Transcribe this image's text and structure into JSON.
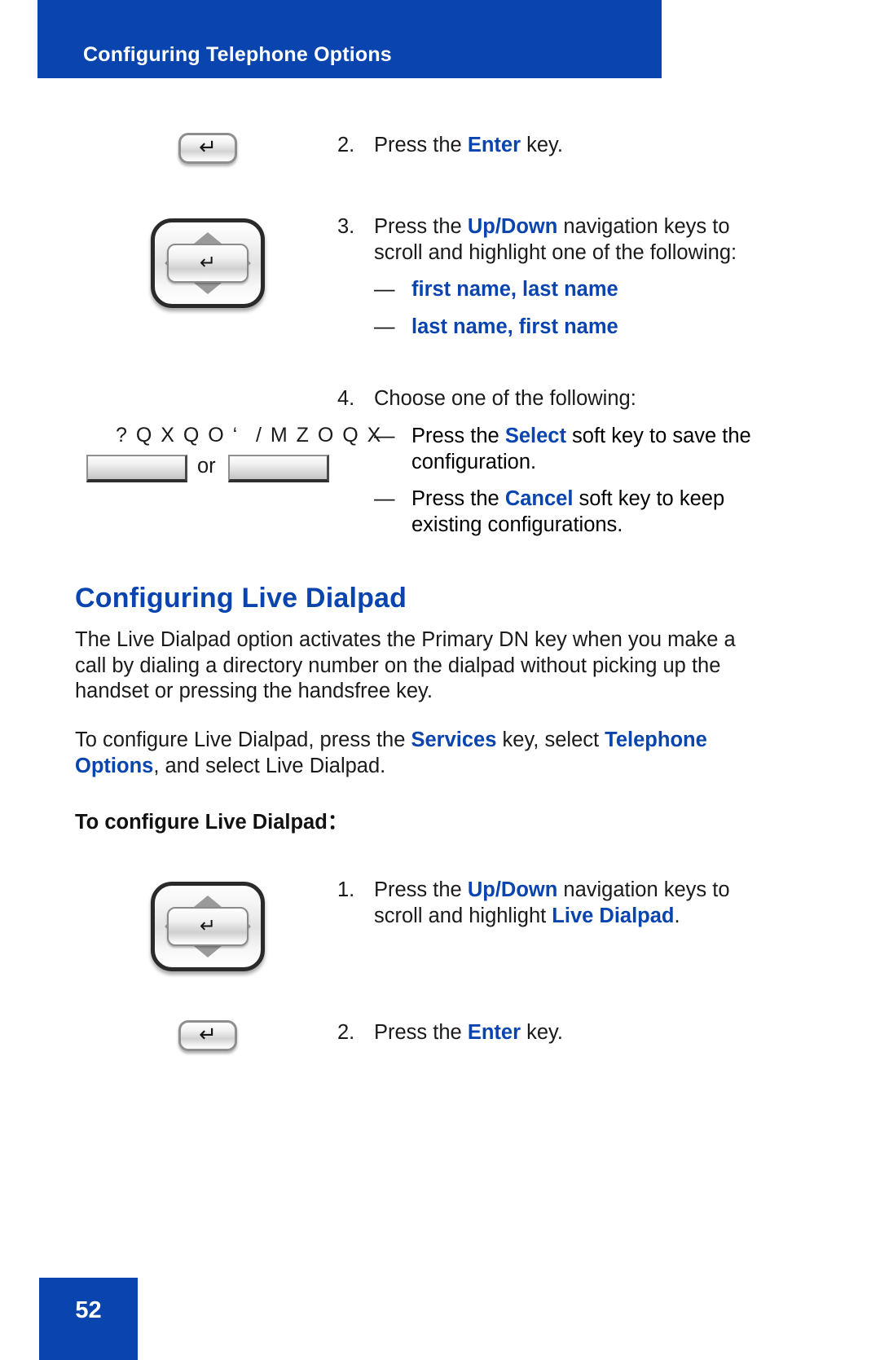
{
  "header": {
    "title": "Configuring Telephone Options"
  },
  "steps_part1": [
    {
      "number": "2.",
      "text_before": "Press the ",
      "keyword": "Enter",
      "text_after": " key.",
      "icon": "enter-key-icon"
    },
    {
      "number": "3.",
      "line1_before": "Press the ",
      "keyword1": "Up",
      "separator": "/",
      "keyword2": "Down",
      "line1_after": " navigation keys to",
      "line2": "scroll and highlight one of the following:",
      "icon": "navigation-cluster-icon",
      "options": [
        {
          "dash": "—",
          "label": "first name, last name"
        },
        {
          "dash": "—",
          "label": "last name, first name"
        }
      ]
    },
    {
      "number": "4.",
      "text": "Choose one of the following:",
      "choices": [
        {
          "dash": "—",
          "line1_before": "Press the ",
          "keyword": "Select",
          "line1_after": " soft key to save the",
          "line2": "configuration."
        },
        {
          "dash": "—",
          "line1_before": "Press the ",
          "keyword": "Cancel",
          "line1_after": " soft key to keep",
          "line2": "existing configurations."
        }
      ]
    }
  ],
  "softkeys": {
    "select_label": "? Q X Q O ‘",
    "cancel_label": "/ M Z O Q X",
    "or_text": "or"
  },
  "section": {
    "heading": "Configuring Live Dialpad",
    "paragraph1_line1": "The Live Dialpad option activates the Primary DN key when you make a",
    "paragraph1_line2": "call by dialing a directory number on the dialpad without picking up the",
    "paragraph1_line3": "handset or pressing the handsfree key.",
    "paragraph2_line1_a": "To configure Live Dialpad, press the ",
    "paragraph2_keyword1": "Services",
    "paragraph2_line1_b": " key, select ",
    "paragraph2_keyword2": "Telephone",
    "paragraph2_keyword3": "Options",
    "paragraph2_line2_b": ", and select Live Dialpad.",
    "sub_heading": "To configure Live Dialpad："
  },
  "steps_part2": [
    {
      "number": "1.",
      "line1_before": "Press the ",
      "keyword1": "Up",
      "separator": "/",
      "keyword2": "Down",
      "line1_after": " navigation keys to",
      "line2_before": "scroll and highlight ",
      "line2_keyword": "Live Dialpad",
      "line2_after": ".",
      "icon": "navigation-cluster-icon"
    },
    {
      "number": "2.",
      "text_before": "Press the ",
      "keyword": "Enter",
      "text_after": " key.",
      "icon": "enter-key-icon"
    }
  ],
  "footer": {
    "page_number": "52"
  },
  "icons": {
    "enter_glyph": "↵",
    "nav_up": "up-triangle-icon",
    "nav_down": "down-triangle-icon",
    "nav_left": "left-triangle-icon",
    "nav_right": "right-triangle-icon"
  },
  "colors": {
    "brand_blue": "#0a44ae",
    "text_black": "#1a1a1a",
    "white": "#ffffff"
  }
}
